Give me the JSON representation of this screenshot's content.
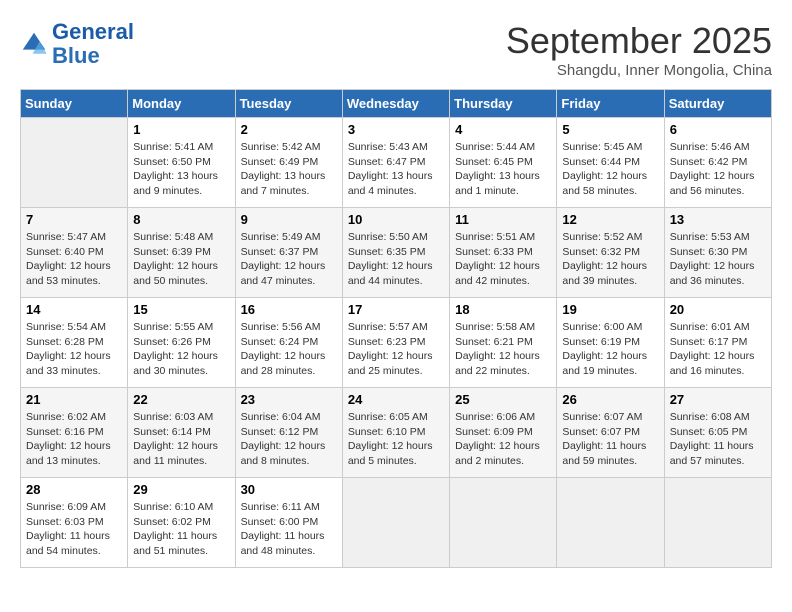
{
  "header": {
    "logo_line1": "General",
    "logo_line2": "Blue",
    "month": "September 2025",
    "location": "Shangdu, Inner Mongolia, China"
  },
  "weekdays": [
    "Sunday",
    "Monday",
    "Tuesday",
    "Wednesday",
    "Thursday",
    "Friday",
    "Saturday"
  ],
  "weeks": [
    [
      {
        "day": "",
        "info": ""
      },
      {
        "day": "1",
        "info": "Sunrise: 5:41 AM\nSunset: 6:50 PM\nDaylight: 13 hours\nand 9 minutes."
      },
      {
        "day": "2",
        "info": "Sunrise: 5:42 AM\nSunset: 6:49 PM\nDaylight: 13 hours\nand 7 minutes."
      },
      {
        "day": "3",
        "info": "Sunrise: 5:43 AM\nSunset: 6:47 PM\nDaylight: 13 hours\nand 4 minutes."
      },
      {
        "day": "4",
        "info": "Sunrise: 5:44 AM\nSunset: 6:45 PM\nDaylight: 13 hours\nand 1 minute."
      },
      {
        "day": "5",
        "info": "Sunrise: 5:45 AM\nSunset: 6:44 PM\nDaylight: 12 hours\nand 58 minutes."
      },
      {
        "day": "6",
        "info": "Sunrise: 5:46 AM\nSunset: 6:42 PM\nDaylight: 12 hours\nand 56 minutes."
      }
    ],
    [
      {
        "day": "7",
        "info": "Sunrise: 5:47 AM\nSunset: 6:40 PM\nDaylight: 12 hours\nand 53 minutes."
      },
      {
        "day": "8",
        "info": "Sunrise: 5:48 AM\nSunset: 6:39 PM\nDaylight: 12 hours\nand 50 minutes."
      },
      {
        "day": "9",
        "info": "Sunrise: 5:49 AM\nSunset: 6:37 PM\nDaylight: 12 hours\nand 47 minutes."
      },
      {
        "day": "10",
        "info": "Sunrise: 5:50 AM\nSunset: 6:35 PM\nDaylight: 12 hours\nand 44 minutes."
      },
      {
        "day": "11",
        "info": "Sunrise: 5:51 AM\nSunset: 6:33 PM\nDaylight: 12 hours\nand 42 minutes."
      },
      {
        "day": "12",
        "info": "Sunrise: 5:52 AM\nSunset: 6:32 PM\nDaylight: 12 hours\nand 39 minutes."
      },
      {
        "day": "13",
        "info": "Sunrise: 5:53 AM\nSunset: 6:30 PM\nDaylight: 12 hours\nand 36 minutes."
      }
    ],
    [
      {
        "day": "14",
        "info": "Sunrise: 5:54 AM\nSunset: 6:28 PM\nDaylight: 12 hours\nand 33 minutes."
      },
      {
        "day": "15",
        "info": "Sunrise: 5:55 AM\nSunset: 6:26 PM\nDaylight: 12 hours\nand 30 minutes."
      },
      {
        "day": "16",
        "info": "Sunrise: 5:56 AM\nSunset: 6:24 PM\nDaylight: 12 hours\nand 28 minutes."
      },
      {
        "day": "17",
        "info": "Sunrise: 5:57 AM\nSunset: 6:23 PM\nDaylight: 12 hours\nand 25 minutes."
      },
      {
        "day": "18",
        "info": "Sunrise: 5:58 AM\nSunset: 6:21 PM\nDaylight: 12 hours\nand 22 minutes."
      },
      {
        "day": "19",
        "info": "Sunrise: 6:00 AM\nSunset: 6:19 PM\nDaylight: 12 hours\nand 19 minutes."
      },
      {
        "day": "20",
        "info": "Sunrise: 6:01 AM\nSunset: 6:17 PM\nDaylight: 12 hours\nand 16 minutes."
      }
    ],
    [
      {
        "day": "21",
        "info": "Sunrise: 6:02 AM\nSunset: 6:16 PM\nDaylight: 12 hours\nand 13 minutes."
      },
      {
        "day": "22",
        "info": "Sunrise: 6:03 AM\nSunset: 6:14 PM\nDaylight: 12 hours\nand 11 minutes."
      },
      {
        "day": "23",
        "info": "Sunrise: 6:04 AM\nSunset: 6:12 PM\nDaylight: 12 hours\nand 8 minutes."
      },
      {
        "day": "24",
        "info": "Sunrise: 6:05 AM\nSunset: 6:10 PM\nDaylight: 12 hours\nand 5 minutes."
      },
      {
        "day": "25",
        "info": "Sunrise: 6:06 AM\nSunset: 6:09 PM\nDaylight: 12 hours\nand 2 minutes."
      },
      {
        "day": "26",
        "info": "Sunrise: 6:07 AM\nSunset: 6:07 PM\nDaylight: 11 hours\nand 59 minutes."
      },
      {
        "day": "27",
        "info": "Sunrise: 6:08 AM\nSunset: 6:05 PM\nDaylight: 11 hours\nand 57 minutes."
      }
    ],
    [
      {
        "day": "28",
        "info": "Sunrise: 6:09 AM\nSunset: 6:03 PM\nDaylight: 11 hours\nand 54 minutes."
      },
      {
        "day": "29",
        "info": "Sunrise: 6:10 AM\nSunset: 6:02 PM\nDaylight: 11 hours\nand 51 minutes."
      },
      {
        "day": "30",
        "info": "Sunrise: 6:11 AM\nSunset: 6:00 PM\nDaylight: 11 hours\nand 48 minutes."
      },
      {
        "day": "",
        "info": ""
      },
      {
        "day": "",
        "info": ""
      },
      {
        "day": "",
        "info": ""
      },
      {
        "day": "",
        "info": ""
      }
    ]
  ]
}
